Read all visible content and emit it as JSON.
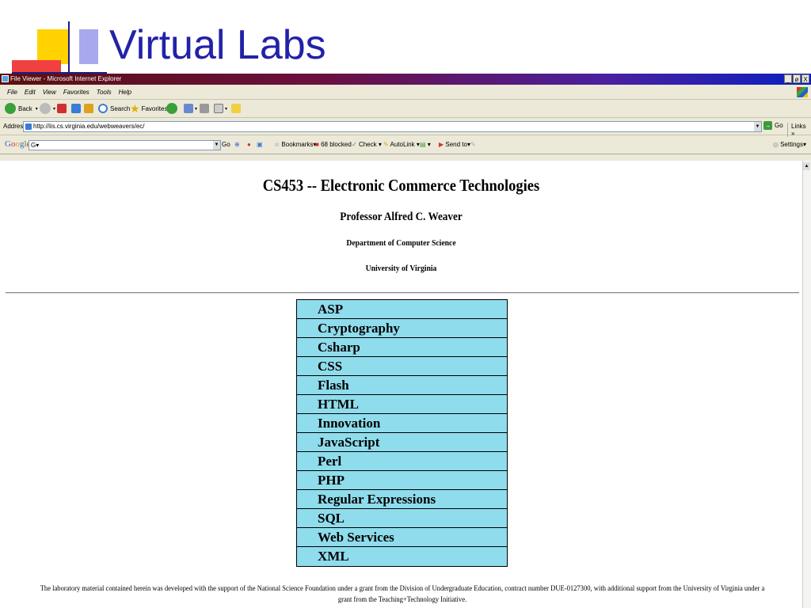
{
  "slide": {
    "title": "Virtual Labs"
  },
  "window": {
    "title": "File Viewer - Microsoft Internet Explorer",
    "buttons": [
      "_",
      "ø",
      "X"
    ]
  },
  "menu": [
    "File",
    "Edit",
    "View",
    "Favorites",
    "Tools",
    "Help"
  ],
  "toolbar": {
    "back": "Back",
    "search": "Search",
    "favorites": "Favorites"
  },
  "address": {
    "label": "Address",
    "url": "http://iis.cs.virginia.edu/webweavers/ec/",
    "go": "Go",
    "links": "Links »"
  },
  "googlebar": {
    "logo": "Google",
    "field": "G▾",
    "go": "Go",
    "bookmarks": "Bookmarks▾",
    "blocked": "68 blocked",
    "check": "Check ▾",
    "autolink": "AutoLink ▾",
    "sendto": "Send to▾",
    "settings": "Settings▾"
  },
  "page": {
    "course_title": "CS453 -- Electronic Commerce Technologies",
    "professor": "Professor Alfred C. Weaver",
    "department": "Department of Computer Science",
    "university": "University of Virginia",
    "topics": [
      "ASP",
      "Cryptography",
      "Csharp",
      "CSS",
      "Flash",
      "HTML",
      "Innovation",
      "JavaScript",
      "Perl",
      "PHP",
      "Regular Expressions",
      "SQL",
      "Web Services",
      "XML"
    ],
    "footer": "The laboratory material contained herein was developed with the support of the National Science Foundation under a grant from the Division of Undergraduate Education, contract number DUE-0127300, with additional support from the University of Virginia under a grant from the Teaching+Technology Initiative."
  },
  "colors": {
    "title": "#2222a8",
    "topic_bg": "#8fdcec",
    "deco_yellow": "#ffd200",
    "deco_red": "#f04040"
  }
}
